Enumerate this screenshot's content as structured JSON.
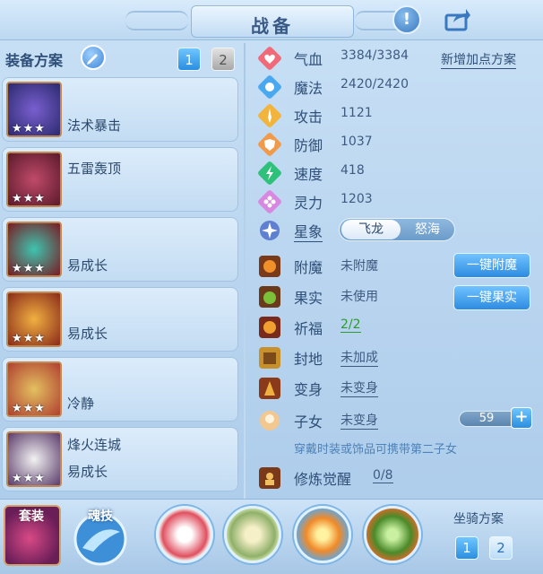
{
  "header": {
    "title": "战备"
  },
  "left": {
    "title": "装备方案",
    "schemes": [
      "1",
      "2"
    ],
    "equipment": [
      {
        "name": "法术暴击",
        "stars": "★★★"
      },
      {
        "name": "五雷轰顶",
        "stars": "★★★"
      },
      {
        "name": "易成长",
        "stars": "★★★"
      },
      {
        "name": "易成长",
        "stars": "★★★"
      },
      {
        "name": "冷静",
        "stars": "★★★"
      },
      {
        "name": "烽火连城",
        "name2": "易成长",
        "stars": "★★★"
      }
    ]
  },
  "stats": {
    "add_plan": "新增加点方案",
    "items": [
      {
        "label": "气血",
        "value": "3384/3384"
      },
      {
        "label": "魔法",
        "value": "2420/2420"
      },
      {
        "label": "攻击",
        "value": "1121"
      },
      {
        "label": "防御",
        "value": "1037"
      },
      {
        "label": "速度",
        "value": "418"
      },
      {
        "label": "灵力",
        "value": "1203"
      }
    ],
    "star_label": "星象",
    "star_options": [
      "飞龙",
      "怒海"
    ],
    "enchant": {
      "label": "附魔",
      "value": "未附魔",
      "button": "一键附魔"
    },
    "fruit": {
      "label": "果实",
      "value": "未使用",
      "button": "一键果实"
    },
    "blessing": {
      "label": "祈福",
      "value": "2/2"
    },
    "seal": {
      "label": "封地",
      "value": "未加成"
    },
    "transform": {
      "label": "变身",
      "value": "未变身"
    },
    "child": {
      "label": "子女",
      "value": "未变身",
      "slider_value": "59"
    },
    "hint": "穿戴时装或饰品可携带第二子女",
    "cultivation": {
      "label": "修炼觉醒",
      "value": "0/8"
    }
  },
  "bottom": {
    "suit_label": "套装",
    "soul_label": "魂技",
    "mount_title": "坐骑方案",
    "mount_schemes": [
      "1",
      "2"
    ]
  },
  "colors": {
    "accent": "#2a8ee0",
    "text": "#2f4f78",
    "green": "#2e9a2e"
  }
}
